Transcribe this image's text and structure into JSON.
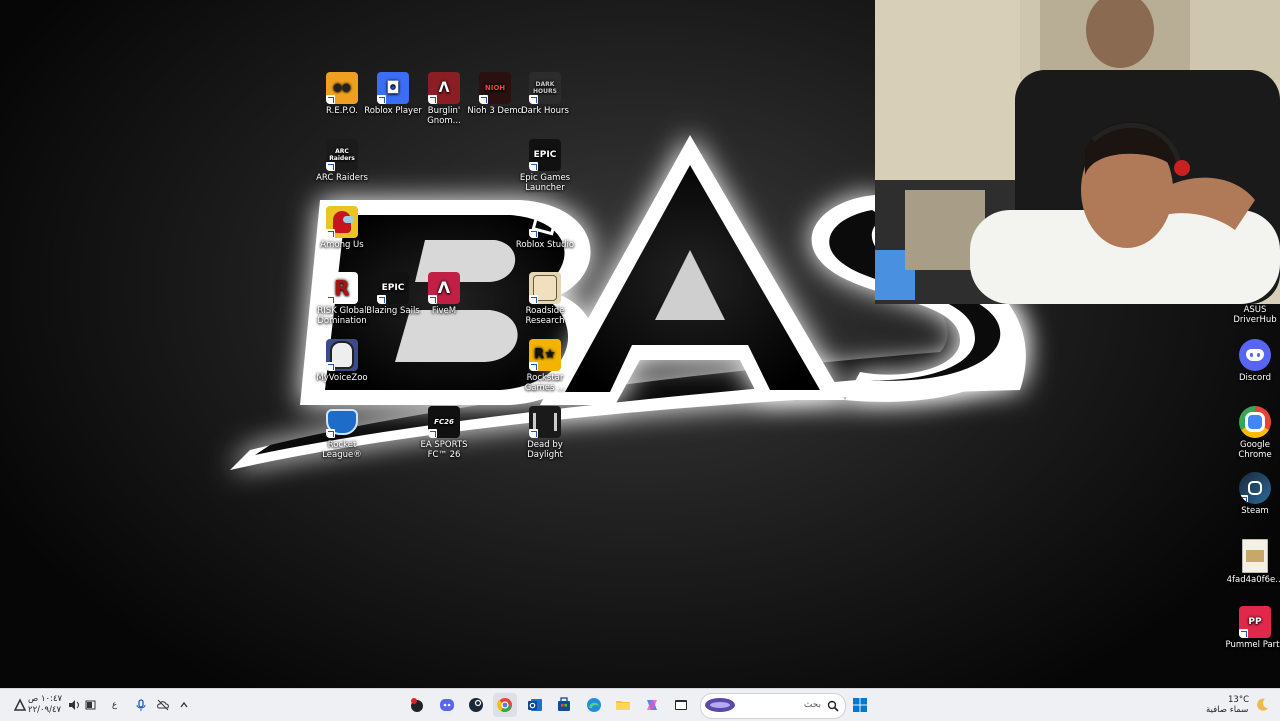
{
  "desktop": {
    "icons": [
      {
        "label": "R.E.P.O.",
        "icon": "repo-icon",
        "color": "#f0a020"
      },
      {
        "label": "Roblox Player",
        "icon": "roblox-icon",
        "color": "#3b6df5"
      },
      {
        "label": "Burglin' Gnom...",
        "icon": "burglin-gnomes-icon",
        "color": "#8a1e24"
      },
      {
        "label": "Nioh 3 Demo",
        "icon": "nioh-icon",
        "color": "#2a1010"
      },
      {
        "label": "Dark Hours",
        "icon": "dark-hours-icon",
        "color": "#2c2c2c"
      },
      {
        "label": "ARC Raiders",
        "icon": "arc-raiders-icon",
        "color": "#1b1b1b"
      },
      {
        "label": "Epic Games Launcher",
        "icon": "epic-games-icon",
        "color": "#111111"
      },
      {
        "label": "Among Us",
        "icon": "among-us-icon",
        "color": "#c8141e"
      },
      {
        "label": "Roblox Studio",
        "icon": "roblox-studio-icon",
        "color": "#222222"
      },
      {
        "label": "RISK Global Domination",
        "icon": "risk-icon",
        "color": "#b01010"
      },
      {
        "label": "Blazing Sails",
        "icon": "epic-games-icon",
        "color": "#111111"
      },
      {
        "label": "FiveM",
        "icon": "fivem-icon",
        "color": "#c21f45"
      },
      {
        "label": "Roadside Research",
        "icon": "roadside-research-icon",
        "color": "#e2d8b8"
      },
      {
        "label": "MyVoiceZoo",
        "icon": "myvoicezoo-icon",
        "color": "#3a4a8a"
      },
      {
        "label": "Rockstar Games ...",
        "icon": "rockstar-icon",
        "color": "#f2b400"
      },
      {
        "label": "Rocket League®",
        "icon": "rocket-league-icon",
        "color": "#1c6cc8"
      },
      {
        "label": "EA SPORTS FC™ 26",
        "icon": "ea-fc-icon",
        "color": "#101010"
      },
      {
        "label": "Dead by Daylight",
        "icon": "dead-by-daylight-icon",
        "color": "#1a1a1a"
      }
    ],
    "glyph_text": {
      "repo": "●●",
      "roblox": "◘",
      "burglin": "Λ",
      "nioh": "NIOH",
      "darkhours": "DARK HOURS",
      "arc": "ARC Raiders",
      "epic": "EPIC",
      "fivem": "Λ",
      "rockstar": "R★"
    },
    "right_icons": [
      {
        "label": "ASUS DriverHub",
        "icon": "asus-icon",
        "color": "#1a1a1a"
      },
      {
        "label": "Discord",
        "icon": "discord-icon",
        "color": "#5865f2"
      },
      {
        "label": "Google Chrome",
        "icon": "chrome-icon",
        "color": "#ffffff"
      },
      {
        "label": "Steam",
        "icon": "steam-icon",
        "color": "#1b2838"
      },
      {
        "label": "4fad4a0f6e...",
        "icon": "image-file-icon",
        "color": "#d9d3c0"
      },
      {
        "label": "Pummel Party",
        "icon": "pummel-party-icon",
        "color": "#e0294a"
      }
    ]
  },
  "wallpaper": {
    "text": "BAS"
  },
  "taskbar": {
    "clock_time": "١٠:٤٧ ص",
    "clock_date": "٢٢/٠٩/٤٧",
    "lang": "ع",
    "search_placeholder": "بحث",
    "weather_temp": "13°C",
    "weather_desc": "سماء صافية"
  },
  "colors": {
    "taskbar_bg": "#eef0f3",
    "accent": "#0078d4"
  }
}
